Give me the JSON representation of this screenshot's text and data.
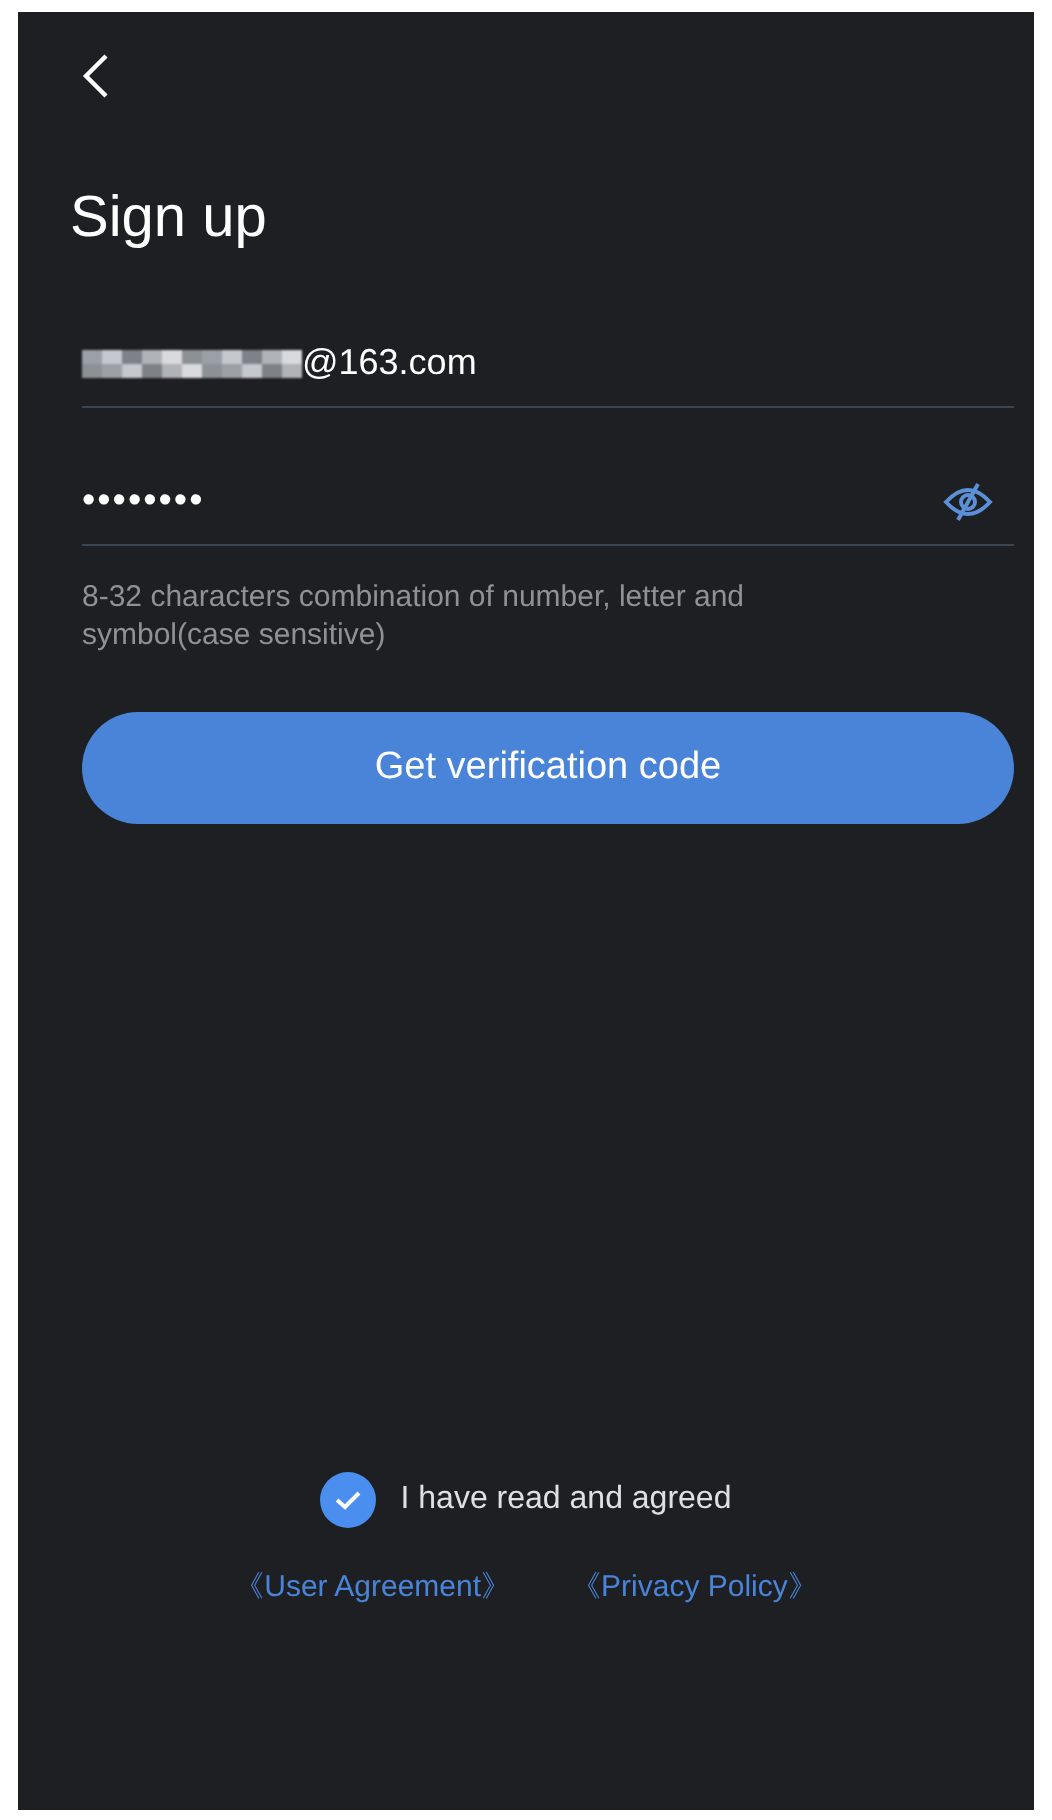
{
  "header": {
    "back": true,
    "title": "Sign up"
  },
  "email": {
    "value": "@163.com",
    "redacted": true
  },
  "password": {
    "value": "••••••••",
    "visible": false,
    "hint": "8-32 characters combination of number, letter and symbol(case sensitive)"
  },
  "submit": {
    "label": "Get verification code"
  },
  "agreement": {
    "checked": true,
    "text": "I have read and agreed",
    "links": [
      "《User Agreement》",
      "《Privacy Policy》"
    ]
  }
}
